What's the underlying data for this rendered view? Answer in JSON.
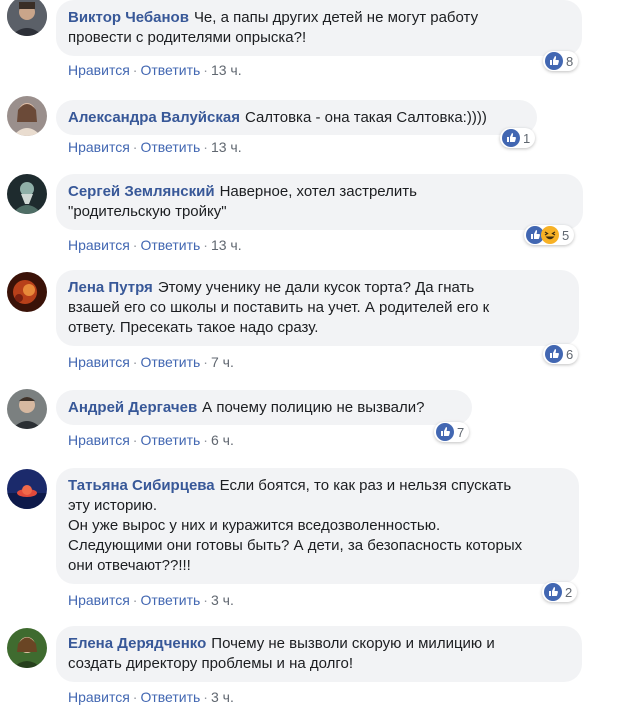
{
  "actions": {
    "like": "Нравится",
    "reply": "Ответить",
    "sep": "·"
  },
  "comments": [
    {
      "author": "Виктор Чебанов",
      "text": "Че, а папы других детей не могут работу\nпровести с родителями опрыска?!",
      "time": "13 ч.",
      "reactions": "8"
    },
    {
      "author": "Александра Валуйская",
      "text": "Салтовка - она такая Салтовка:))))",
      "time": "13 ч.",
      "reactions": "1"
    },
    {
      "author": "Сергей Землянский",
      "text": "Наверное, хотел застрелить\n\"родительскую тройку\"",
      "time": "13 ч.",
      "reactions": "5"
    },
    {
      "author": "Лена Путря",
      "text": "Этому ученику не дали кусок торта? Да гнать\nвзашей его со школы и поставить на учет. А родителей его к\nответу. Пресекать такое надо сразу.",
      "time": "7 ч.",
      "reactions": "6"
    },
    {
      "author": "Андрей Дергачев",
      "text": "А почему полицию не вызвали?",
      "time": "6 ч.",
      "reactions": "7"
    },
    {
      "author": "Татьяна Сибирцева",
      "text": "Если боятся, то как раз и нельзя спускать\nэту историю.\nОн уже вырос у них и куражится вседозволенностью.\nСледующими они готовы быть? А дети, за безопасность которых\nони отвечают??!!!",
      "time": "3 ч.",
      "reactions": "2"
    },
    {
      "author": "Елена Дерядченко",
      "text": "Почему не вызволи скорую и милицию и\nсоздать директору проблемы и на долго!",
      "time": "3 ч.",
      "reactions": ""
    }
  ],
  "colors": {
    "link": "#4267b2",
    "author": "#385898",
    "bubble": "#f2f3f5",
    "like_icon": "#4267b2",
    "haha_icon": "#f7b125"
  }
}
